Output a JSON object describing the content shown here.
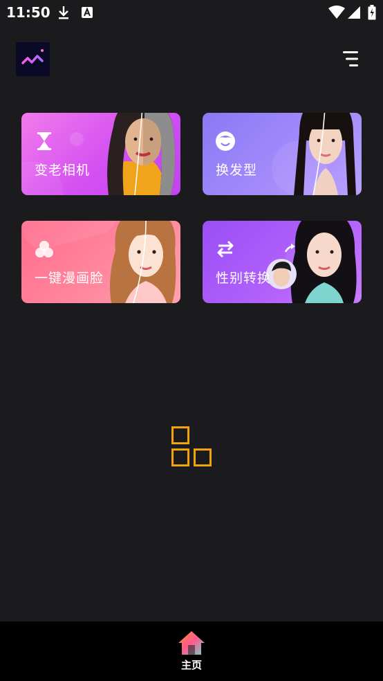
{
  "status_bar": {
    "time": "11:50",
    "icons": [
      "download-icon",
      "font-icon",
      "wifi-icon",
      "signal-icon",
      "battery-icon"
    ]
  },
  "header": {
    "logo_icon": "mountain-chart-icon",
    "menu_icon": "menu-icon"
  },
  "cards": [
    {
      "label": "变老相机",
      "icon": "hourglass-icon",
      "colors": [
        "#f070e8",
        "#c040f0"
      ]
    },
    {
      "label": "换发型",
      "icon": "face-hair-icon",
      "colors": [
        "#8f7cf6",
        "#b59cff"
      ]
    },
    {
      "label": "一键漫画脸",
      "icon": "triple-circle-icon",
      "colors": [
        "#ff6f8e",
        "#ff9aa8"
      ]
    },
    {
      "label": "性别转换",
      "icon": "swap-arrows-icon",
      "colors": [
        "#9a52f5",
        "#c377ff"
      ]
    }
  ],
  "loading": {
    "icon": "grid-squares-icon",
    "color": "#f0a30a"
  },
  "bottom_nav": {
    "home_label": "主页",
    "home_icon": "home-icon"
  }
}
